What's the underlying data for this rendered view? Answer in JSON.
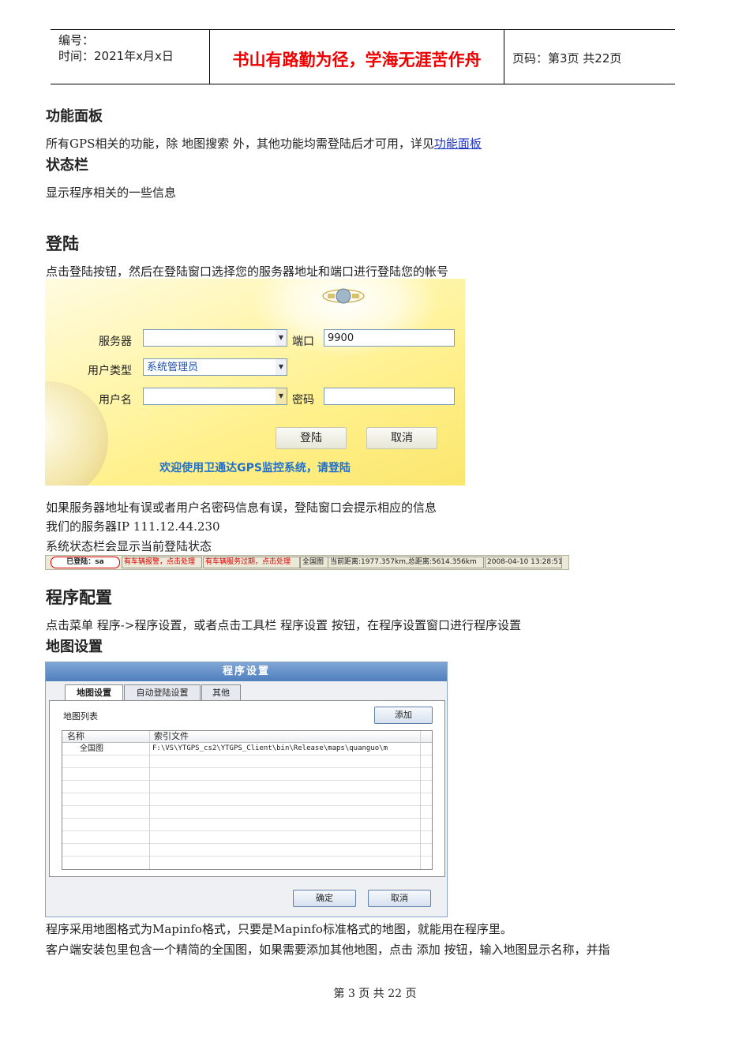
{
  "header": {
    "number_label": "编号：",
    "time_label": "时间：2021年x月x日",
    "motto": "书山有路勤为径，学海无涯苦作舟",
    "page_info": "页码：第3页  共22页"
  },
  "sections": {
    "func_panel_title": "功能面板",
    "func_panel_text": "所有GPS相关的功能，除  地图搜索  外，其他功能均需登陆后才可用，详见",
    "func_panel_link": "功能面板",
    "status_title": "状态栏",
    "status_text": "显示程序相关的一些信息",
    "login_title": "登陆",
    "login_text": "点击登陆按钮，然后在登陆窗口选择您的服务器地址和端口进行登陆您的帐号",
    "login_after_1": "如果服务器地址有误或者用户名密码信息有误，登陆窗口会提示相应的信息",
    "login_after_2": "我们的服务器IP  111.12.44.230",
    "login_after_3": "系统状态栏会显示当前登陆状态",
    "config_title": "程序配置",
    "config_text": "点击菜单  程序->程序设置，或者点击工具栏  程序设置  按钮，在程序设置窗口进行程序设置",
    "map_settings_title": "地图设置",
    "map_text_1": "程序采用地图格式为Mapinfo格式，只要是Mapinfo标准格式的地图，就能用在程序里。",
    "map_text_2": "客户端安装包里包含一个精简的全国图，如果需要添加其他地图，点击  添加  按钮，输入地图显示名称，并指"
  },
  "login_dialog": {
    "server_label": "服务器",
    "server_value": "",
    "port_label": "端口",
    "port_value": "9900",
    "user_type_label": "用户类型",
    "user_type_value": "系统管理员",
    "username_label": "用户名",
    "username_value": "",
    "password_label": "密码",
    "password_value": "",
    "login_button": "登陆",
    "cancel_button": "取消",
    "welcome": "欢迎使用卫通达GPS监控系统，请登陆"
  },
  "status_bar": {
    "login_state": "已登陆：sa",
    "alarm": "有车辆报警，点击处理",
    "expired": "有车辆服务过期，点击处理",
    "map": "全国图",
    "distance": "当前距离:1977.357km,总距离:5614.356km",
    "datetime": "2008-04-10 13:28:51"
  },
  "settings_dialog": {
    "title": "程序设置",
    "tabs": [
      "地图设置",
      "自动登陆设置",
      "其他"
    ],
    "map_list_label": "地图列表",
    "add_button": "添加",
    "columns": [
      "名称",
      "索引文件"
    ],
    "rows": [
      {
        "name": "全国图",
        "file": "F:\\VS\\YTGPS_cs2\\YTGPS_Client\\bin\\Release\\maps\\quanguo\\m"
      }
    ],
    "ok_button": "确定",
    "cancel_button": "取消"
  },
  "footer": "第 3 页 共 22 页"
}
